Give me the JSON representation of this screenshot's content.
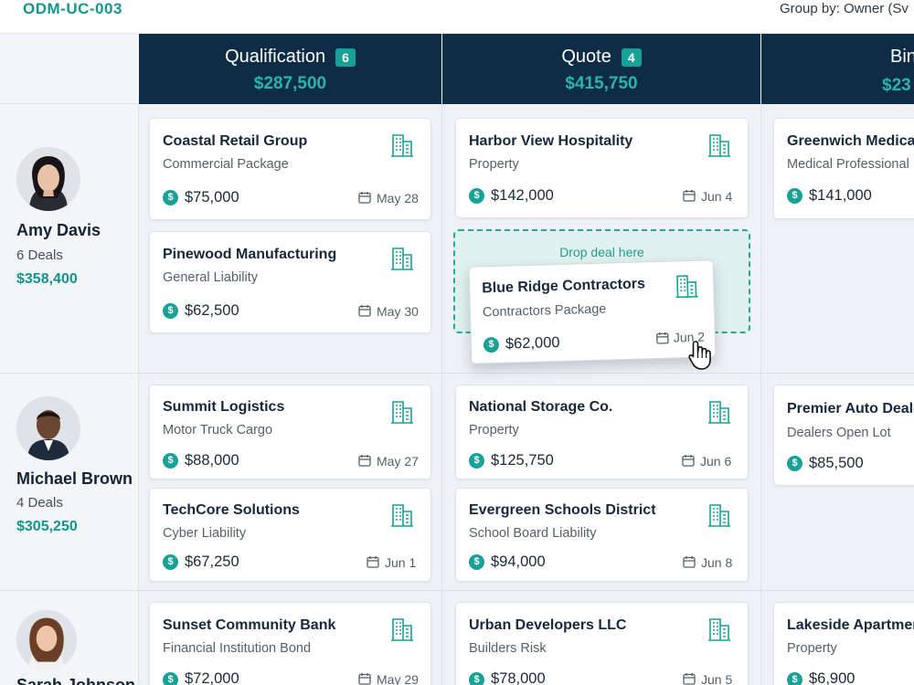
{
  "screen_id": "ODM-UC-003",
  "group_by_label": "Group by: Owner (Sv",
  "stages": [
    {
      "name": "Qualification",
      "count": "6",
      "total": "$287,500"
    },
    {
      "name": "Quote",
      "count": "4",
      "total": "$415,750"
    },
    {
      "name": "Bin",
      "count": "",
      "total": "$23"
    }
  ],
  "owners": [
    {
      "name": "Amy Davis",
      "deals": "6 Deals",
      "value": "$358,400"
    },
    {
      "name": "Michael Brown",
      "deals": "4 Deals",
      "value": "$305,250"
    },
    {
      "name": "Sarah Johnson",
      "deals": "",
      "value": ""
    }
  ],
  "cards": {
    "c1": {
      "name": "Coastal Retail Group",
      "type": "Commercial Package",
      "amount": "$75,000",
      "date": "May 28"
    },
    "c2": {
      "name": "Pinewood Manufacturing",
      "type": "General Liability",
      "amount": "$62,500",
      "date": "May 30"
    },
    "c3": {
      "name": "Harbor View Hospitality",
      "type": "Property",
      "amount": "$142,000",
      "date": "Jun 4"
    },
    "c4": {
      "name": "Greenwich Medical",
      "type": "Medical Professional",
      "amount": "$141,000",
      "date": ""
    },
    "c5": {
      "name": "Summit Logistics",
      "type": "Motor Truck Cargo",
      "amount": "$88,000",
      "date": "May 27"
    },
    "c6": {
      "name": "TechCore Solutions",
      "type": "Cyber Liability",
      "amount": "$67,250",
      "date": "Jun 1"
    },
    "c7": {
      "name": "National Storage Co.",
      "type": "Property",
      "amount": "$125,750",
      "date": "Jun 6"
    },
    "c8": {
      "name": "Evergreen Schools District",
      "type": "School Board Liability",
      "amount": "$94,000",
      "date": "Jun 8"
    },
    "c9": {
      "name": "Premier Auto Dealers",
      "type": "Dealers Open Lot",
      "amount": "$85,500",
      "date": ""
    },
    "c10": {
      "name": "Sunset Community Bank",
      "type": "Financial Institution Bond",
      "amount": "$72,000",
      "date": "May 29"
    },
    "c11": {
      "name": "Urban Developers LLC",
      "type": "Builders Risk",
      "amount": "$78,000",
      "date": "Jun 5"
    },
    "c12": {
      "name": "Lakeside Apartments",
      "type": "Property",
      "amount": "$6,900",
      "date": ""
    }
  },
  "drop_zone_label": "Drop deal here",
  "dragging_card": {
    "name": "Blue Ridge Contractors",
    "type": "Contractors Package",
    "amount": "$62,000",
    "date": "Jun 2"
  },
  "icons": {
    "amount": "dollar-icon",
    "date": "calendar-icon",
    "account": "building-icon",
    "cursor": "hand-pointer-icon"
  },
  "colors": {
    "header": "#0f2c47",
    "accent": "#18a196",
    "total_text": "#2bb5a7"
  }
}
